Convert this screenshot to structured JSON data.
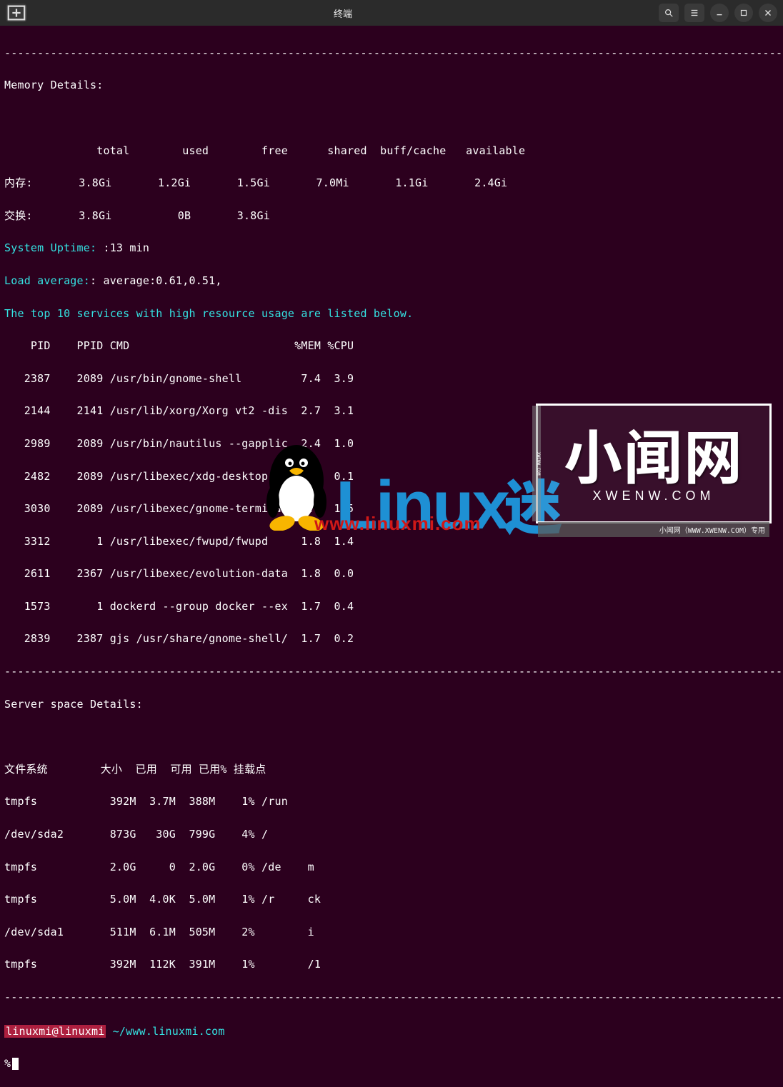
{
  "window": {
    "title": "终端"
  },
  "dash_line": "-----------------------------------------------------------------------------------------------------------------------",
  "mem_header": "Memory Details:",
  "mem_cols": "              total        used        free      shared  buff/cache   available",
  "mem_row": "内存:       3.8Gi       1.2Gi       1.5Gi       7.0Mi       1.1Gi       2.4Gi",
  "swap_row": "交换:       3.8Gi          0B       3.8Gi",
  "uptime_label": "System Uptime: ",
  "uptime_value": ":13 min",
  "load_label": "Load average:",
  "load_value": ": average:0.61,0.51,",
  "services_header": "The top 10 services with high resource usage are listed below.",
  "ps_header": "    PID    PPID CMD                         %MEM %CPU",
  "ps": [
    "   2387    2089 /usr/bin/gnome-shell         7.4  3.9",
    "   2144    2141 /usr/lib/xorg/Xorg vt2 -dis  2.7  3.1",
    "   2989    2089 /usr/bin/nautilus --gapplic  2.4  1.0",
    "   2482    2089 /usr/libexec/xdg-desktop-po  2.1  0.1",
    "   3030    2089 /usr/libexec/gnome-terminal  2.0  1.5",
    "   3312       1 /usr/libexec/fwupd/fwupd     1.8  1.4",
    "   2611    2367 /usr/libexec/evolution-data  1.8  0.0",
    "   1573       1 dockerd --group docker --ex  1.7  0.4",
    "   2839    2387 gjs /usr/share/gnome-shell/  1.7  0.2"
  ],
  "space_header": "Server space Details:",
  "fs_header": "文件系统        大小  已用  可用 已用% 挂载点",
  "fs": [
    "tmpfs           392M  3.7M  388M    1% /run",
    "/dev/sda2       873G   30G  799G    4% /",
    "tmpfs           2.0G     0  2.0G    0% /de    m",
    "tmpfs           5.0M  4.0K  5.0M    1% /r     ck",
    "/dev/sda1       511M  6.1M  505M    2%        i",
    "tmpfs           392M  112K  391M    1%        /1"
  ],
  "prompt_user": "linuxmi@linuxmi",
  "prompt_sep": " ",
  "prompt_path": "~/www.linuxmi.com",
  "prompt_symbol": "%",
  "overlay": {
    "big": "小闻网",
    "small": "XWENW.COM",
    "foot": "小闻网（WWW.XWENW.COM）专用",
    "linux_word": "Linux",
    "linux_mi": "迷",
    "linux_url": "www.linuxmi.com"
  }
}
